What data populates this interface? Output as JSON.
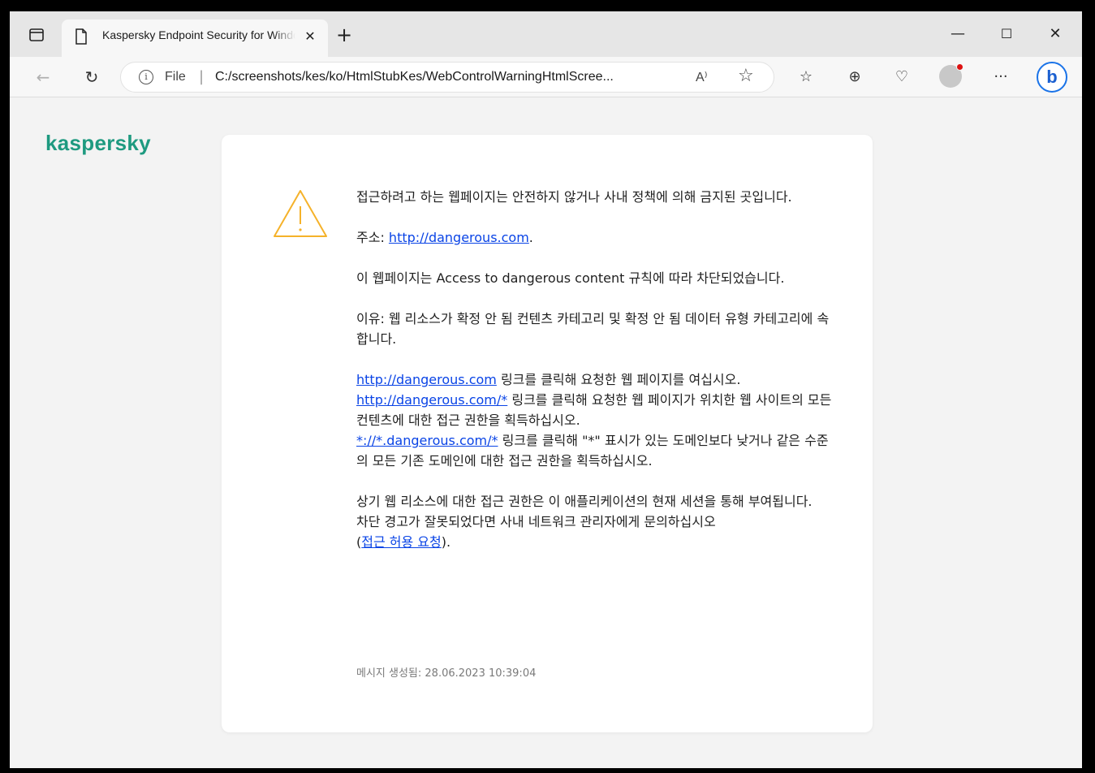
{
  "browser": {
    "tab": {
      "title": "Kaspersky Endpoint Security for Windows",
      "close_glyph": "✕"
    },
    "new_tab_glyph": "+",
    "window_controls": {
      "minimize": "—",
      "maximize": "☐",
      "close": "✕"
    },
    "address": {
      "scheme": "File",
      "separator": "|",
      "url": "C:/screenshots/kes/ko/HtmlStubKes/WebControlWarningHtmlScree...",
      "read_aloud": "A⁾"
    }
  },
  "page": {
    "logo": "kaspersky",
    "intro": "접근하려고 하는 웹페이지는 안전하지 않거나 사내 정책에 의해 금지된 곳입니다.",
    "address_label": "주소: ",
    "address_link": "http://dangerous.com",
    "address_suffix": ".",
    "blocked_rule": "이 웹페이지는 Access to dangerous content 규칙에 따라 차단되었습니다.",
    "reason": "이유: 웹 리소스가 확정 안 됨 컨텐츠 카테고리 및 확정 안 됨 데이터 유형 카테고리에 속합니다.",
    "links": [
      {
        "link": "http://dangerous.com",
        "text": " 링크를 클릭해 요청한 웹 페이지를 여십시오."
      },
      {
        "link": "http://dangerous.com/*",
        "text": " 링크를 클릭해 요청한 웹 페이지가 위치한 웹 사이트의 모든 컨텐츠에 대한 접근 권한을 획득하십시오."
      },
      {
        "link": "*://*.dangerous.com/*",
        "text": " 링크를 클릭해 \"*\" 표시가 있는 도메인보다 낮거나 같은 수준의 모든 기존 도메인에 대한 접근 권한을 획득하십시오."
      }
    ],
    "session_note": "상기 웹 리소스에 대한 접근 권한은 이 애플리케이션의 현재 세션을 통해 부여됩니다.",
    "contact_note": "차단 경고가 잘못되었다면 사내 네트워크 관리자에게 문의하십시오",
    "request_prefix": "(",
    "request_link": "접근 허용 요청",
    "request_suffix": ").",
    "generated": "메시지 생성됨: 28.06.2023 10:39:04"
  },
  "colors": {
    "brand": "#1e9a80",
    "warning": "#f5b22a",
    "link": "#0a44e6"
  }
}
